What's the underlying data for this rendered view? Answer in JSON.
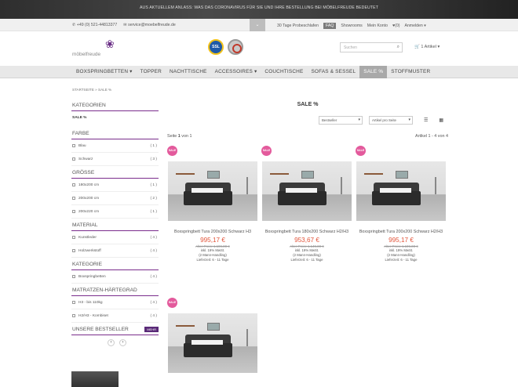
{
  "banner": {
    "text": "AUS AKTUELLEM ANLASS: WAS DAS CORONAVIRUS FÜR SIE UND IHRE BESTELLUNG BEI MÖBELFREUDE BEDEUTET"
  },
  "topbar": {
    "phone": "+49 (0) 521-44813377",
    "email": "service@moebelfreude.de",
    "toggle": "⌄",
    "links": [
      "30 Tage Probeschlafen",
      "FAQ",
      "Showrooms",
      "Mein Konto",
      "(0)",
      "Anmelden ▾"
    ]
  },
  "header": {
    "logo_text": "möbelfreude",
    "ssl_text": "SSL",
    "search_placeholder": "Suchen",
    "cart_text": "1 Artikel ▾"
  },
  "nav": {
    "items": [
      "BOXSPRINGBETTEN ▾",
      "TOPPER",
      "NACHTTISCHE",
      "ACCESSOIRES ▾",
      "COUCHTISCHE",
      "SOFAS & SESSEL",
      "SALE %",
      "STOFFMUSTER"
    ],
    "active": "SALE %"
  },
  "breadcrumb": "STARTSEITE » SALE %",
  "sidebar": {
    "kategorien": {
      "title": "KATEGORIEN",
      "items": [
        {
          "label": "SALE %",
          "count": ""
        }
      ]
    },
    "farbe": {
      "title": "FARBE",
      "items": [
        {
          "label": "Blau",
          "count": "( 1 )"
        },
        {
          "label": "Schwarz",
          "count": "( 3 )"
        }
      ]
    },
    "groesse": {
      "title": "GRÖSSE",
      "items": [
        {
          "label": "180x200 cm",
          "count": "( 1 )"
        },
        {
          "label": "200x200 cm",
          "count": "( 2 )"
        },
        {
          "label": "200x220 cm",
          "count": "( 1 )"
        }
      ]
    },
    "material": {
      "title": "MATERIAL",
      "items": [
        {
          "label": "Kunstleder",
          "count": "( 4 )"
        },
        {
          "label": "Holzwerkstoff",
          "count": "( 4 )"
        }
      ]
    },
    "kategorie": {
      "title": "KATEGORIE",
      "items": [
        {
          "label": "Boxspringbetten",
          "count": "( 4 )"
        }
      ]
    },
    "matratzen": {
      "title": "MATRATZEN-HÄRTEGRAD",
      "items": [
        {
          "label": "H3 - bis 110kg",
          "count": "( 4 )"
        },
        {
          "label": "H2/H3 - Kombiset",
          "count": "( 4 )"
        }
      ]
    },
    "bestseller": {
      "title": "UNSERE BESTSELLER",
      "more": "MEHR",
      "prev": "‹",
      "next": "›"
    }
  },
  "main": {
    "title": "SALE %",
    "sort": "Bestseller",
    "per_page": "Artikel pro Seite",
    "grid_icon": "▦",
    "list_icon": "☰",
    "page_label": "Seite",
    "page_num": "1",
    "page_of": "von 1",
    "range": "Artikel 1 - 4 von 4",
    "products": [
      {
        "badge": "SALE",
        "name": "Boxspringbett Tura 200x200 Schwarz H3",
        "price": "995,17 €",
        "old": "Alter Preis: 1.199,00 €",
        "vat": "inkl. 19% MwSt.",
        "delivery_extra": "(2 Mann-Handling)",
        "ship": "Lieferzeit: 6 - 11 Tage"
      },
      {
        "badge": "SALE",
        "name": "Boxspringbett Tura 180x200 Schwarz H2/H3",
        "price": "953,67 €",
        "old": "Alter Preis: 1.149,00 €",
        "vat": "inkl. 19% MwSt.",
        "delivery_extra": "(2 Mann-Handling)",
        "ship": "Lieferzeit: 6 - 11 Tage"
      },
      {
        "badge": "SALE",
        "name": "Boxspringbett Tura 200x200 Schwarz H2/H3",
        "price": "995,17 €",
        "old": "Alter Preis: 1.199,00 €",
        "vat": "inkl. 19% MwSt.",
        "delivery_extra": "(2 Mann-Handling)",
        "ship": "Lieferzeit: 6 - 11 Tage"
      },
      {
        "badge": "SALE"
      }
    ]
  }
}
